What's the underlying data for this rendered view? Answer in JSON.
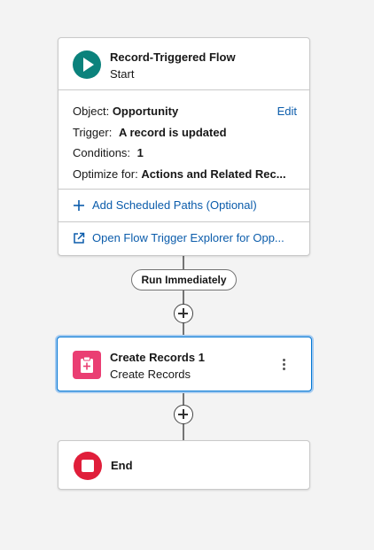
{
  "start": {
    "title": "Record-Triggered Flow",
    "subtitle": "Start",
    "edit_label": "Edit",
    "details": [
      {
        "label": "Object:",
        "value": "Opportunity"
      },
      {
        "label": "Trigger:",
        "value": "A record is updated"
      },
      {
        "label": "Conditions:",
        "value": "1"
      },
      {
        "label": "Optimize for:",
        "value": "Actions and Related Rec..."
      }
    ],
    "add_scheduled_paths": "Add Scheduled Paths (Optional)",
    "open_explorer": "Open Flow Trigger Explorer for Opp..."
  },
  "path_label": "Run Immediately",
  "create_records": {
    "title": "Create Records 1",
    "subtitle": "Create Records"
  },
  "end": {
    "label": "End"
  },
  "colors": {
    "start_icon": "#0b827c",
    "create_icon": "#ea3e73",
    "end_icon": "#e01e3a",
    "link": "#0b5cab",
    "selected_border": "#0176d3"
  },
  "icons": {
    "start": "play-icon",
    "create": "clipboard-plus-icon",
    "end": "stop-icon",
    "add_path": "plus-icon",
    "explorer": "external-link-icon",
    "menu": "more-vertical-icon",
    "insert": "add-element-icon"
  }
}
